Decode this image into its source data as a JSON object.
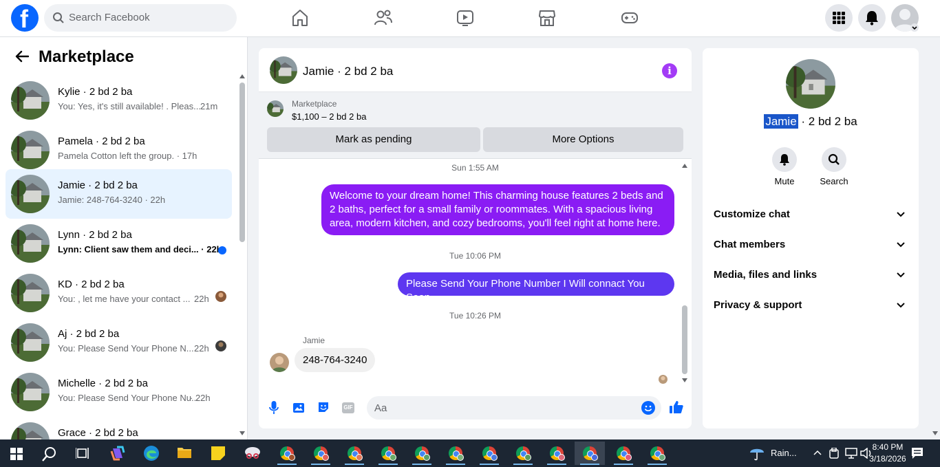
{
  "search": {
    "placeholder": "Search Facebook"
  },
  "logo": {
    "glyph": "f"
  },
  "nav": {
    "icons": [
      "home-icon",
      "friends-icon",
      "video-icon",
      "marketplace-icon",
      "gaming-icon"
    ],
    "right_icons": [
      "menu-grid-icon",
      "notifications-bell-icon",
      "profile-avatar"
    ]
  },
  "sidebar": {
    "title": "Marketplace",
    "conversations": [
      {
        "name": "Kylie · 2 bd 2 ba",
        "preview": "You: Yes, it's still available! . Pleas...",
        "time": "21m"
      },
      {
        "name": "Pamela · 2 bd 2 ba",
        "preview": "Pamela Cotton left the group. · 17h",
        "time": ""
      },
      {
        "name": "Jamie · 2 bd 2 ba",
        "preview": "Jamie: 248-764-3240 · 22h",
        "time": ""
      },
      {
        "name": "Lynn · 2 bd 2 ba",
        "preview": "Lynn: Client saw them and deci... · 22h",
        "time": "",
        "unread": true
      },
      {
        "name": "KD · 2 bd 2 ba",
        "preview": "You: , let me have your contact ...",
        "time": "22h"
      },
      {
        "name": "Aj · 2 bd 2 ba",
        "preview": "You: Please Send Your Phone N...",
        "time": "22h"
      },
      {
        "name": "Michelle · 2 bd 2 ba",
        "preview": "You: Please Send Your Phone Nu...",
        "time": "· 22h"
      },
      {
        "name": "Grace · 2 bd 2 ba",
        "preview": "",
        "time": ""
      }
    ]
  },
  "chat": {
    "title": "Jamie · 2 bd 2 ba",
    "listing": {
      "source": "Marketplace",
      "price": "$1,100 – 2 bd 2 ba"
    },
    "buttons": {
      "pending": "Mark as pending",
      "more": "More Options"
    },
    "timestamps": [
      "Sun 1:55 AM",
      "Tue 10:06 PM",
      "Tue 10:26 PM"
    ],
    "messages": [
      {
        "from": "me",
        "text": "Welcome to your dream home! This charming house features 2 beds and 2 baths, perfect for a small family or roommates. With a spacious living area, modern kitchen, and cozy bedrooms, you'll feel right at home here."
      },
      {
        "from": "me",
        "text": "Please Send Your Phone Number I Will connact You Soon"
      },
      {
        "from": "Jamie",
        "text": "248-764-3240"
      }
    ],
    "sender_label": "Jamie",
    "composer_placeholder": "Aa",
    "gif_label": "GIF"
  },
  "info_panel": {
    "name_highlight": "Jamie",
    "name_rest": " · 2 bd 2 ba",
    "mute_label": "Mute",
    "search_label": "Search",
    "sections": [
      "Customize chat",
      "Chat members",
      "Media, files and links",
      "Privacy & support"
    ]
  },
  "taskbar": {
    "weather": "Rain...",
    "time": "8:40 PM",
    "date": "3/18/2026"
  },
  "colors": {
    "brand": "#0866ff",
    "bubble_purple": "#8a1cf4",
    "bubble_indigo": "#5d37f0",
    "active_row": "#e7f3ff"
  }
}
